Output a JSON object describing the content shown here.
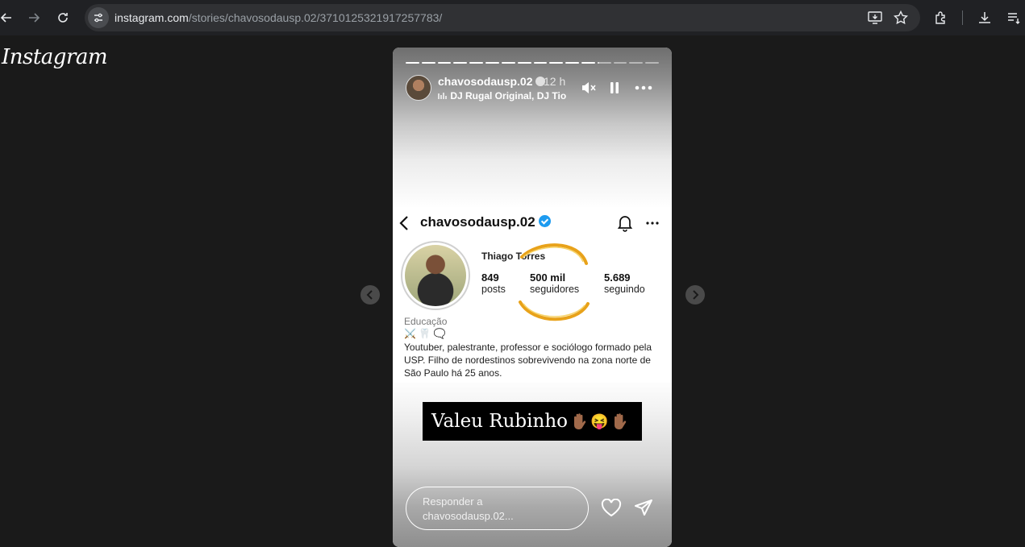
{
  "browser": {
    "url_host": "instagram.com",
    "url_path": "/stories/chavosodausp.02/3710125321917257783/"
  },
  "app": {
    "logo": "Instagram"
  },
  "story": {
    "username": "chavosodausp.02",
    "time_ago": "12 h",
    "music": "DJ Rugal Original, DJ Tio Jo",
    "progress": {
      "segments": 16,
      "completed": 12,
      "current_fraction": 0.1
    },
    "profile": {
      "username": "chavosodausp.02",
      "full_name": "Thiago Torres",
      "stats": [
        {
          "value": "849",
          "label": "posts"
        },
        {
          "value": "500 mil",
          "label": "seguidores"
        },
        {
          "value": "5.689",
          "label": "seguindo"
        }
      ],
      "category": "Educação",
      "bio_emoji": "⚔️ 🦷 🗨️",
      "bio": "Youtuber, palestrante, professor e sociólogo formado pela USP. Filho de nordestinos sobrevivendo na zona norte de São Paulo há 25 anos."
    },
    "caption": "Valeu Rubinho",
    "caption_emoji_mid": "😝",
    "reply_placeholder": "Responder a chavosodausp.02..."
  }
}
